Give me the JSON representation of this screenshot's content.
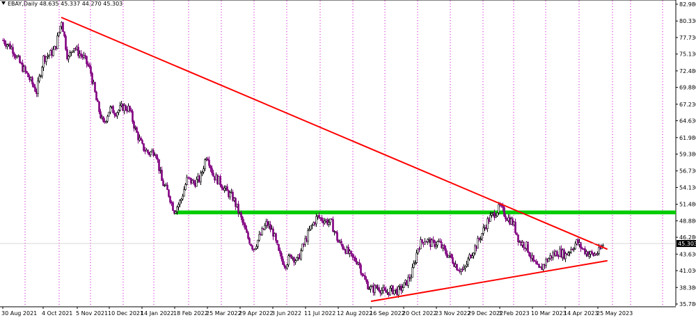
{
  "header": {
    "symbol": "EBAY,Daily",
    "open": "48.635",
    "high": "45.337",
    "low": "44.270",
    "close": "45.303"
  },
  "chart_data": {
    "type": "candlestick",
    "symbol": "EBAY",
    "timeframe": "Daily",
    "ylim": [
      35.78,
      82.98
    ],
    "y_ticks": [
      "82.980",
      "80.330",
      "77.730",
      "75.130",
      "72.480",
      "69.880",
      "67.230",
      "64.630",
      "61.980",
      "59.380",
      "56.730",
      "54.130",
      "51.480",
      "48.880",
      "46.280",
      "43.630",
      "41.030",
      "38.380",
      "35.780"
    ],
    "x_ticks": [
      "30 Aug 2021",
      "4 Oct 2021",
      "5 Nov 2021",
      "10 Dec 2021",
      "14 Jan 2022",
      "18 Feb 2022",
      "25 Mar 2022",
      "29 Apr 2022",
      "3 Jun 2022",
      "11 Jul 2022",
      "12 Aug 2022",
      "16 Sep 2022",
      "20 Oct 2022",
      "23 Nov 2022",
      "29 Dec 2022",
      "3 Feb 2023",
      "10 Mar 2023",
      "14 Apr 2023",
      "25 May 2023"
    ],
    "current_price": "45.303",
    "price_path": [
      [
        "2021-08-30",
        77.3
      ],
      [
        "2021-09-07",
        76.0
      ],
      [
        "2021-09-14",
        73.5
      ],
      [
        "2021-09-21",
        71.5
      ],
      [
        "2021-09-28",
        69.2
      ],
      [
        "2021-10-04",
        74.5
      ],
      [
        "2021-10-11",
        75.2
      ],
      [
        "2021-10-15",
        76.0
      ],
      [
        "2021-10-21",
        80.5
      ],
      [
        "2021-10-27",
        74.2
      ],
      [
        "2021-11-01",
        76.5
      ],
      [
        "2021-11-05",
        75.5
      ],
      [
        "2021-11-12",
        74.5
      ],
      [
        "2021-11-19",
        72.5
      ],
      [
        "2021-11-26",
        67.5
      ],
      [
        "2021-12-03",
        64.0
      ],
      [
        "2021-12-10",
        66.5
      ],
      [
        "2021-12-17",
        66.0
      ],
      [
        "2021-12-24",
        66.8
      ],
      [
        "2021-12-31",
        66.5
      ],
      [
        "2022-01-07",
        63.0
      ],
      [
        "2022-01-14",
        60.5
      ],
      [
        "2022-01-21",
        59.5
      ],
      [
        "2022-01-28",
        60.0
      ],
      [
        "2022-02-04",
        55.0
      ],
      [
        "2022-02-11",
        53.2
      ],
      [
        "2022-02-17",
        50.5
      ],
      [
        "2022-02-24",
        52.0
      ],
      [
        "2022-03-03",
        55.5
      ],
      [
        "2022-03-10",
        54.8
      ],
      [
        "2022-03-17",
        55.5
      ],
      [
        "2022-03-24",
        59.5
      ],
      [
        "2022-03-31",
        56.0
      ],
      [
        "2022-04-07",
        55.0
      ],
      [
        "2022-04-14",
        53.5
      ],
      [
        "2022-04-21",
        52.5
      ],
      [
        "2022-04-29",
        49.5
      ],
      [
        "2022-05-06",
        46.5
      ],
      [
        "2022-05-13",
        44.5
      ],
      [
        "2022-05-20",
        46.5
      ],
      [
        "2022-05-27",
        48.5
      ],
      [
        "2022-06-03",
        47.0
      ],
      [
        "2022-06-10",
        43.5
      ],
      [
        "2022-06-17",
        42.0
      ],
      [
        "2022-06-24",
        43.5
      ],
      [
        "2022-07-01",
        42.5
      ],
      [
        "2022-07-08",
        45.0
      ],
      [
        "2022-07-15",
        47.5
      ],
      [
        "2022-07-22",
        49.5
      ],
      [
        "2022-07-29",
        49.0
      ],
      [
        "2022-08-05",
        48.5
      ],
      [
        "2022-08-12",
        45.5
      ],
      [
        "2022-08-19",
        44.5
      ],
      [
        "2022-08-26",
        43.0
      ],
      [
        "2022-09-02",
        42.5
      ],
      [
        "2022-09-09",
        39.5
      ],
      [
        "2022-09-16",
        38.0
      ],
      [
        "2022-09-23",
        38.5
      ],
      [
        "2022-09-30",
        37.5
      ],
      [
        "2022-10-07",
        38.0
      ],
      [
        "2022-10-14",
        37.8
      ],
      [
        "2022-10-21",
        38.8
      ],
      [
        "2022-10-28",
        40.5
      ],
      [
        "2022-11-04",
        45.0
      ],
      [
        "2022-11-11",
        46.0
      ],
      [
        "2022-11-18",
        45.2
      ],
      [
        "2022-11-25",
        45.5
      ],
      [
        "2022-12-02",
        44.0
      ],
      [
        "2022-12-09",
        43.0
      ],
      [
        "2022-12-16",
        41.5
      ],
      [
        "2022-12-23",
        41.0
      ],
      [
        "2022-12-30",
        43.5
      ],
      [
        "2023-01-06",
        45.0
      ],
      [
        "2023-01-13",
        47.0
      ],
      [
        "2023-01-20",
        49.0
      ],
      [
        "2023-01-27",
        50.0
      ],
      [
        "2023-02-03",
        51.0
      ],
      [
        "2023-02-10",
        49.5
      ],
      [
        "2023-02-17",
        48.5
      ],
      [
        "2023-02-24",
        45.5
      ],
      [
        "2023-03-03",
        45.0
      ],
      [
        "2023-03-10",
        42.5
      ],
      [
        "2023-03-17",
        41.0
      ],
      [
        "2023-03-24",
        42.5
      ],
      [
        "2023-03-31",
        43.5
      ],
      [
        "2023-04-07",
        44.0
      ],
      [
        "2023-04-14",
        43.5
      ],
      [
        "2023-04-21",
        44.5
      ],
      [
        "2023-04-28",
        45.5
      ],
      [
        "2023-05-05",
        44.5
      ],
      [
        "2023-05-12",
        43.8
      ],
      [
        "2023-05-19",
        43.5
      ],
      [
        "2023-05-26",
        44.0
      ],
      [
        "2023-06-01",
        45.3
      ]
    ],
    "annotations": {
      "resistance_zone": {
        "from": "2022-02-17",
        "to_edge": true,
        "y_low": 49.9,
        "y_high": 50.5,
        "color": "#00cc00"
      },
      "descending_trendline": {
        "start": [
          "2021-10-21",
          80.9
        ],
        "end": [
          "2023-06-06",
          44.4
        ],
        "color": "#ff0000"
      },
      "ascending_trendline": {
        "start": [
          "2022-09-16",
          36.2
        ],
        "end": [
          "2023-06-06",
          42.6
        ],
        "color": "#ff0000"
      },
      "current_price_line_color": "#c0c0c0"
    },
    "colors": {
      "bullish": "#000000",
      "bearish": "#800080",
      "grid_vertical": "#cc00cc",
      "axis": "#000000",
      "price_tag_bg": "#000000",
      "price_tag_fg": "#ffffff"
    }
  }
}
